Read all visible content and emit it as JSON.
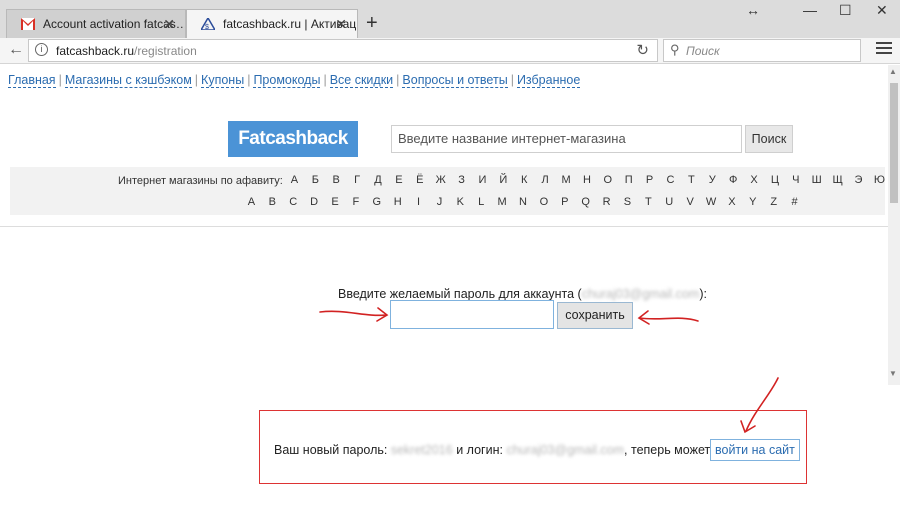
{
  "browser": {
    "tabs": [
      {
        "title": "Account activation fatcas…",
        "active": false,
        "favicon": "gmail-icon"
      },
      {
        "title": "fatcashback.ru | Активаци…",
        "active": true,
        "favicon": "site-icon"
      }
    ],
    "url_host": "fatcashback.ru",
    "url_path": "/registration",
    "search_placeholder": "Поиск"
  },
  "nav": {
    "items": [
      "Главная",
      "Магазины с кэшбэком",
      "Купоны",
      "Промокоды",
      "Все скидки",
      "Вопросы и ответы",
      "Избранное"
    ]
  },
  "header": {
    "logo": "Fatcashback",
    "search_placeholder": "Введите название интернет-магазина",
    "search_button": "Поиск"
  },
  "alphabet": {
    "label": "Интернет магазины по афавиту:",
    "ru": [
      "А",
      "Б",
      "В",
      "Г",
      "Д",
      "Е",
      "Ё",
      "Ж",
      "З",
      "И",
      "Й",
      "К",
      "Л",
      "М",
      "Н",
      "О",
      "П",
      "Р",
      "С",
      "Т",
      "У",
      "Ф",
      "Х",
      "Ц",
      "Ч",
      "Ш",
      "Щ",
      "Э",
      "Ю"
    ],
    "en": [
      "A",
      "B",
      "C",
      "D",
      "E",
      "F",
      "G",
      "H",
      "I",
      "J",
      "K",
      "L",
      "M",
      "N",
      "O",
      "P",
      "Q",
      "R",
      "S",
      "T",
      "U",
      "V",
      "W",
      "X",
      "Y",
      "Z",
      "#"
    ]
  },
  "form": {
    "prompt_before": "Введите желаемый пароль для аккаунта (",
    "prompt_email": "churaj03@gmail.com",
    "prompt_after": "):",
    "save_button": "сохранить"
  },
  "result": {
    "text1": "Ваш новый пароль:",
    "password": "sekret2016",
    "text2": "и логин:",
    "login": "churaj03@gmail.com",
    "text3": ", теперь можете",
    "login_button": "войти на сайт"
  },
  "colors": {
    "accent": "#4b93d6",
    "arrow": "#d22222",
    "link": "#2b6cb0"
  }
}
